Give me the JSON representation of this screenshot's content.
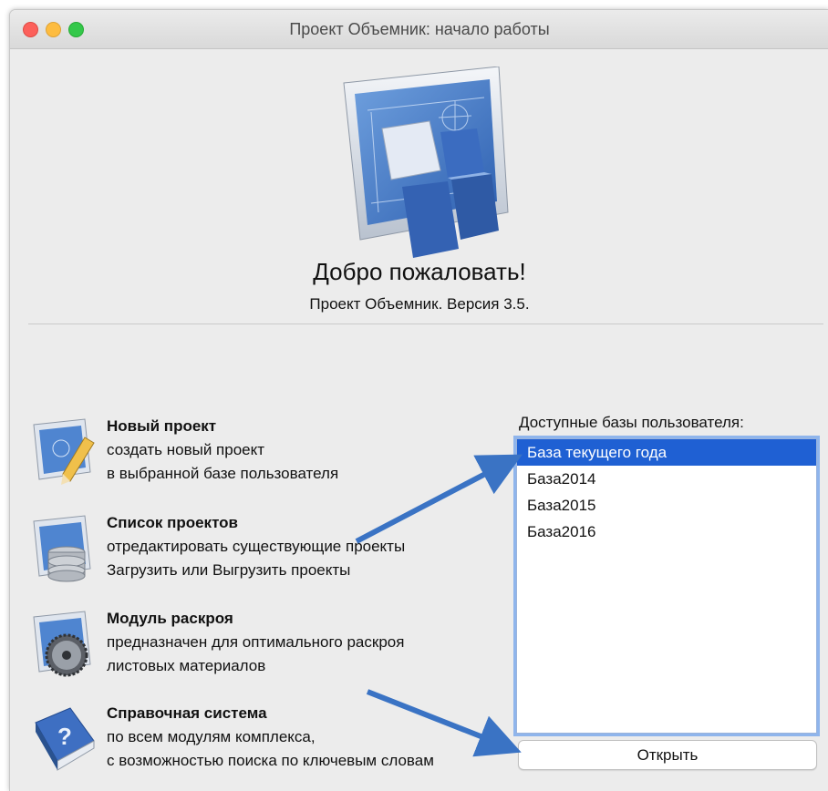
{
  "window": {
    "title": "Проект Объемник: начало работы"
  },
  "welcome": {
    "heading": "Добро пожаловать!",
    "version": "Проект Объемник. Версия 3.5."
  },
  "menu": [
    {
      "title": "Новый проект",
      "line1": "создать новый проект",
      "line2": "в выбранной базе пользователя",
      "icon": "blueprint-pencil-icon"
    },
    {
      "title": "Список проектов",
      "line1": "отредактировать существующие проекты",
      "line2": "Загрузить или Выгрузить проекты",
      "icon": "blueprint-database-icon"
    },
    {
      "title": "Модуль раскроя",
      "line1": "предназначен для оптимального раскроя",
      "line2": "листовых материалов",
      "icon": "blueprint-saw-icon"
    },
    {
      "title": "Справочная система",
      "line1": "по всем модулям комплекса,",
      "line2": "с возможностью поиска по ключевым словам",
      "icon": "help-book-icon"
    }
  ],
  "databases": {
    "label": "Доступные базы пользователя:",
    "items": [
      "База текущего года",
      "База2014",
      "База2015",
      "База2016"
    ],
    "selected": "База текущего года"
  },
  "open_button": "Открыть",
  "colors": {
    "selection": "#1f60d3",
    "arrow": "#3a73c4",
    "focus_ring": "#8fb5ec"
  }
}
